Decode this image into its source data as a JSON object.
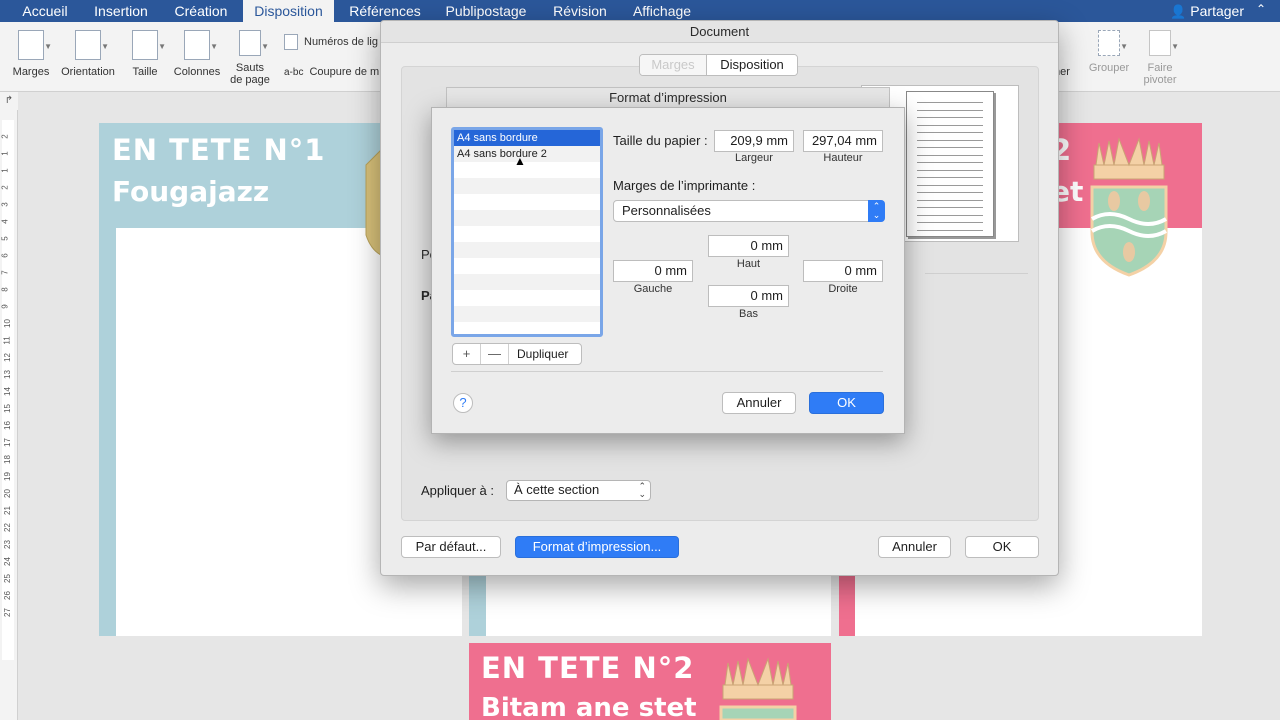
{
  "ribbon_tabs": [
    "Accueil",
    "Insertion",
    "Création",
    "Disposition",
    "Références",
    "Publipostage",
    "Révision",
    "Affichage"
  ],
  "active_tab": "Disposition",
  "share_label": "Partager",
  "ribbon": {
    "marges": "Marges",
    "orientation": "Orientation",
    "taille": "Taille",
    "colonnes": "Colonnes",
    "sauts_line1": "Sauts",
    "sauts_line2": "de page",
    "numeros": "Numéros de lig",
    "coupure": "Coupure de m",
    "bc_icon": "a-bc",
    "aligner_cut": "ner",
    "grouper": "Grouper",
    "faire_line1": "Faire",
    "faire_line2": "pivoter"
  },
  "ruler_numbers": [
    "2",
    "1",
    "1",
    "2",
    "3",
    "4",
    "5",
    "6",
    "7",
    "8",
    "9",
    "10",
    "11",
    "12",
    "13",
    "14",
    "15",
    "16",
    "17",
    "18",
    "19",
    "20",
    "21",
    "22",
    "23",
    "24",
    "25",
    "26",
    "27"
  ],
  "pages": {
    "p1_title": "EN TETE N°1",
    "p1_sub": "Fougajazz",
    "p3_title_cut": "2",
    "p3_sub_cut": "et",
    "p4_title": "EN TETE N°2",
    "p4_sub": "Bitam ane stet"
  },
  "document_dialog": {
    "title": "Document",
    "segment_marges": "Marges",
    "segment_disposition": "Disposition",
    "partial_label_1": "Po",
    "partial_label_2": "Pa",
    "apply_label": "Appliquer à :",
    "apply_value": "À cette section",
    "btn_default": "Par défaut...",
    "btn_print_format": "Format d’impression...",
    "btn_cancel": "Annuler",
    "btn_ok": "OK"
  },
  "format_dialog": {
    "title": "Format d’impression",
    "list_items": [
      "A4 sans bordure",
      "A4 sans bordure 2"
    ],
    "selected_index": 0,
    "add_icon": "+",
    "remove_icon": "—",
    "btn_duplicate": "Dupliquer",
    "paper_size_label": "Taille du papier :",
    "width_value": "209,9 mm",
    "width_caption": "Largeur",
    "height_value": "297,04 mm",
    "height_caption": "Hauteur",
    "margins_label": "Marges de l’imprimante :",
    "margins_select": "Personnalisées",
    "top_value": "0 mm",
    "top_caption": "Haut",
    "left_value": "0 mm",
    "left_caption": "Gauche",
    "right_value": "0 mm",
    "right_caption": "Droite",
    "bottom_value": "0 mm",
    "bottom_caption": "Bas",
    "help_icon": "?",
    "btn_cancel": "Annuler",
    "btn_ok": "OK"
  },
  "colors": {
    "ribbon_blue": "#2b579a",
    "header_blue": "#aed1da",
    "header_pink": "#ef6f8f",
    "accent_blue": "#2f7cf6",
    "selection_blue": "#2566d8"
  }
}
